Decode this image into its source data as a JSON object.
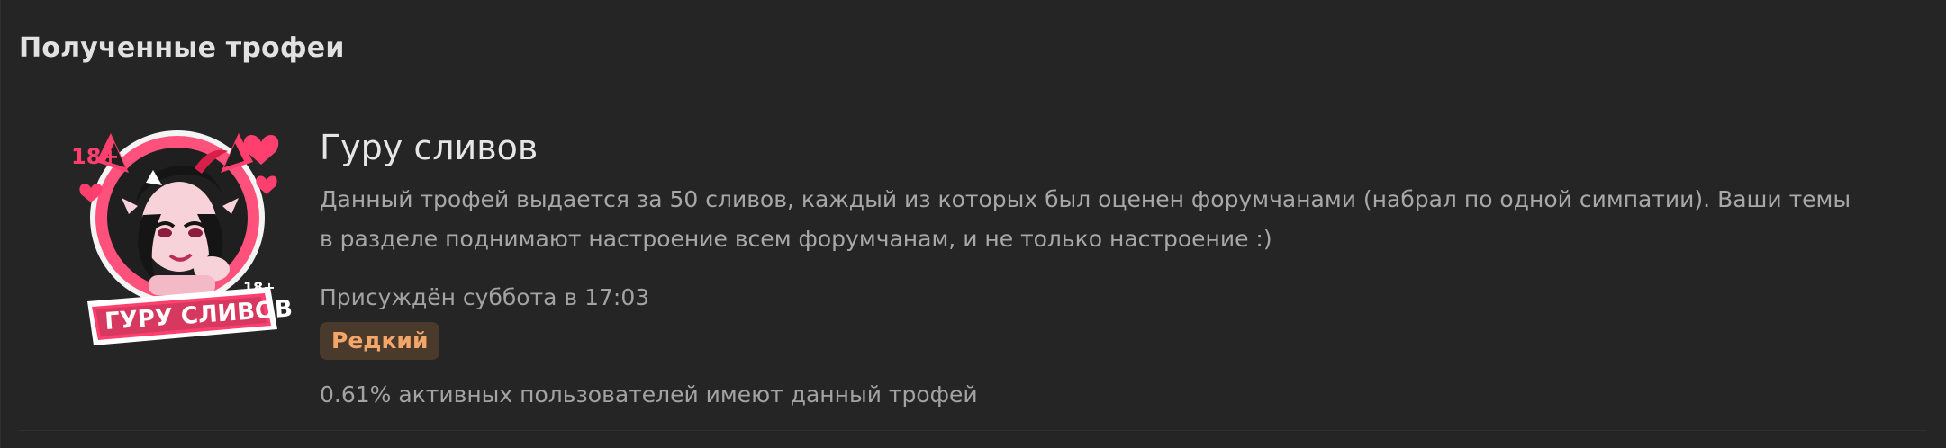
{
  "section": {
    "title": "Полученные трофеи"
  },
  "trophy": {
    "title": "Гуру сливов",
    "description": "Данный трофей выдается за 50 сливов, каждый из которых был оценен форумчанами (набрал по одной симпатии). Ваши темы в разделе поднимают настроение всем форумчанам, и не только настроение :)",
    "awarded": "Присуждён суббота в 17:03",
    "rarity": "Редкий",
    "share": "0.61% активных пользователей имеют данный трофей",
    "badge": {
      "age_label_top": "18+",
      "age_label_bottom": "18+",
      "banner_text": "ГУРУ СЛИВОВ",
      "icon": "character-badge-icon",
      "colors": {
        "pink": "#ff3f6e",
        "dark_banner": "#1d1d1d",
        "white": "#ffffff"
      }
    }
  },
  "colors": {
    "background": "#252525",
    "title_text": "#e2e2e2",
    "muted_text": "#a8a8a8",
    "rarity_bg": "#4a3a2c",
    "rarity_text": "#f3a66a"
  }
}
